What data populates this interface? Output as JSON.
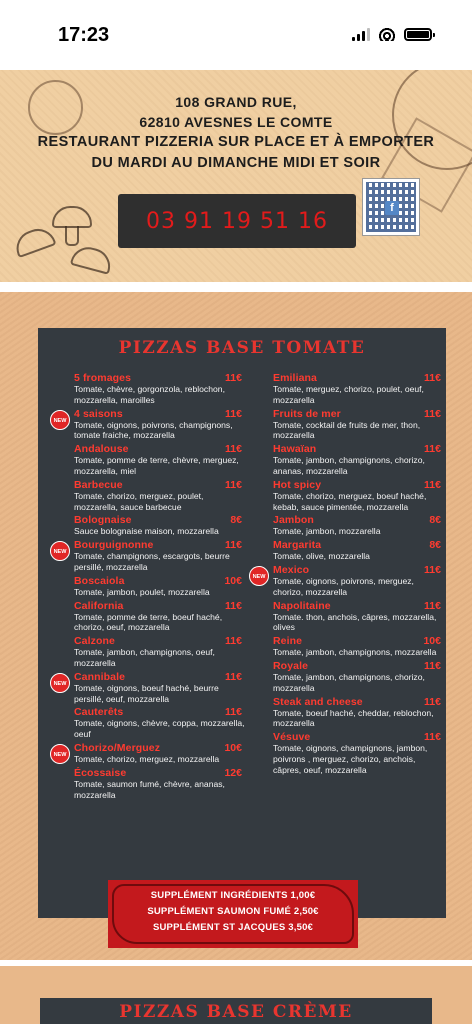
{
  "status_bar": {
    "time": "17:23"
  },
  "header": {
    "address_line1": "108 GRAND RUE,",
    "address_line2": "62810 AVESNES LE COMTE",
    "tagline": "RESTAURANT PIZZERIA SUR PLACE ET À EMPORTER",
    "hours": "DU MARDI AU DIMANCHE MIDI ET SOIR",
    "phone": "03 91 19 51 16",
    "qr_badge": "f"
  },
  "menu": {
    "title": "PIZZAS BASE TOMATE",
    "new_badge_label": "NEW",
    "left_column": [
      {
        "name": "5 fromages",
        "price": "11€",
        "desc": "Tomate, chèvre, gorgonzola, reblochon, mozzarella, maroilles",
        "new": false
      },
      {
        "name": "4 saisons",
        "price": "11€",
        "desc": "Tomate, oignons, poivrons, champignons, tomate fraiche, mozzarella",
        "new": true
      },
      {
        "name": "Andalouse",
        "price": "11€",
        "desc": "Tomate, pomme de terre, chèvre, merguez, mozzarella, miel",
        "new": false
      },
      {
        "name": "Barbecue",
        "price": "11€",
        "desc": "Tomate, chorizo, merguez, poulet, mozzarella, sauce barbecue",
        "new": false
      },
      {
        "name": "Bolognaise",
        "price": "8€",
        "desc": "Sauce bolognaise maison, mozzarella",
        "new": false
      },
      {
        "name": "Bourguignonne",
        "price": "11€",
        "desc": "Tomate, champignons, escargots, beurre persillé, mozzarella",
        "new": true
      },
      {
        "name": "Boscaiola",
        "price": "10€",
        "desc": "Tomate, jambon, poulet, mozzarella",
        "new": false
      },
      {
        "name": "California",
        "price": "11€",
        "desc": "Tomate, pomme de terre, boeuf haché, chorizo, oeuf, mozzarella",
        "new": false
      },
      {
        "name": "Calzone",
        "price": "11€",
        "desc": "Tomate, jambon, champignons, oeuf, mozzarella",
        "new": false
      },
      {
        "name": "Cannibale",
        "price": "11€",
        "desc": "Tomate, oignons, boeuf haché, beurre persillé, oeuf, mozzarella",
        "new": true
      },
      {
        "name": "Cauterêts",
        "price": "11€",
        "desc": "Tomate, oignons, chèvre, coppa, mozzarella, oeuf",
        "new": false
      },
      {
        "name": "Chorizo/Merguez",
        "price": "10€",
        "desc": "Tomate, chorizo, merguez, mozzarella",
        "new": true
      },
      {
        "name": "Écossaise",
        "price": "12€",
        "desc": "Tomate, saumon fumé, chèvre, ananas, mozzarella",
        "new": false
      }
    ],
    "right_column": [
      {
        "name": "Emiliana",
        "price": "11€",
        "desc": "Tomate, merguez, chorizo, poulet, oeuf, mozzarella",
        "new": false
      },
      {
        "name": "Fruits de mer",
        "price": "11€",
        "desc": "Tomate, cocktail de fruits de mer, thon, mozzarella",
        "new": false
      },
      {
        "name": "Hawaïan",
        "price": "11€",
        "desc": "Tomate, jambon, champignons, chorizo, ananas, mozzarella",
        "new": false
      },
      {
        "name": "Hot spicy",
        "price": "11€",
        "desc": "Tomate, chorizo, merguez, boeuf haché, kebab, sauce pimentée, mozzarella",
        "new": false
      },
      {
        "name": "Jambon",
        "price": "8€",
        "desc": "Tomate, jambon, mozzarella",
        "new": false
      },
      {
        "name": "Margarita",
        "price": "8€",
        "desc": "Tomate, olive, mozzarella",
        "new": false
      },
      {
        "name": "Mexico",
        "price": "11€",
        "desc": "Tomate, oignons, poivrons, merguez, chorizo, mozzarella",
        "new": true
      },
      {
        "name": "Napolitaine",
        "price": "11€",
        "desc": "Tomate. thon, anchois, câpres, mozzarella, olives",
        "new": false
      },
      {
        "name": "Reine",
        "price": "10€",
        "desc": "Tomate, jambon, champignons, mozzarella",
        "new": false
      },
      {
        "name": "Royale",
        "price": "11€",
        "desc": "Tomate, jambon, champignons, chorizo, mozzarella",
        "new": false
      },
      {
        "name": "Steak and cheese",
        "price": "11€",
        "desc": "Tomate, boeuf haché, cheddar, reblochon, mozzarella",
        "new": false
      },
      {
        "name": "Vésuve",
        "price": "11€",
        "desc": "Tomate, oignons, champignons, jambon, poivrons , merguez, chorizo, anchois, câpres, oeuf, mozzarella",
        "new": false
      }
    ],
    "supplements": [
      "SUPPLÉMENT INGRÉDIENTS 1,00€",
      "SUPPLÉMENT SAUMON FUMÉ 2,50€",
      "SUPPLÉMENT ST JACQUES 3,50€"
    ]
  },
  "next_section": {
    "title": "PIZZAS BASE CRÈME"
  }
}
